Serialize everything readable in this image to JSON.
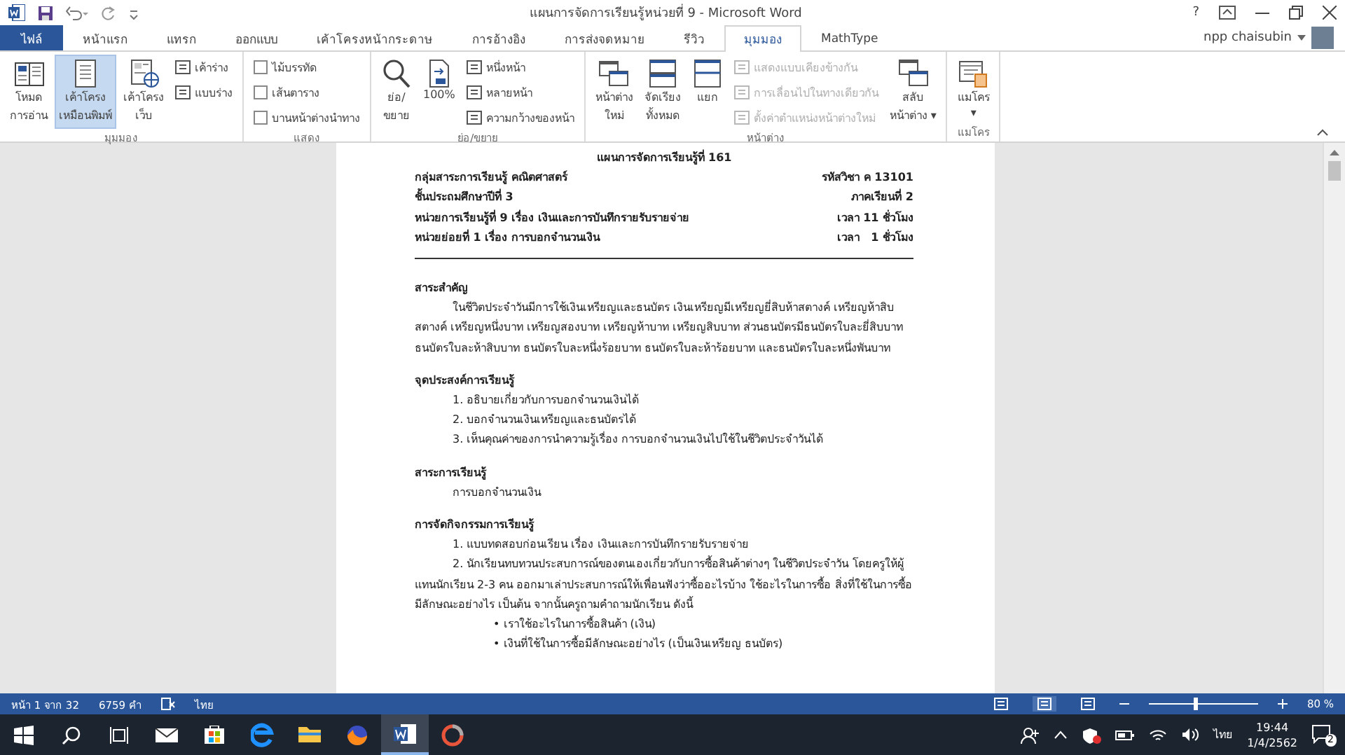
{
  "title_bar": {
    "title": "แผนการจัดการเรียนรู้หน่วยที่ 9 - Microsoft Word",
    "help": "?"
  },
  "tabs": [
    {
      "label": "ไฟล์",
      "kind": "file",
      "selected": false
    },
    {
      "label": "หน้าแรก",
      "kind": "tab",
      "selected": false
    },
    {
      "label": "แทรก",
      "kind": "tab",
      "selected": false
    },
    {
      "label": "ออกแบบ",
      "kind": "tab",
      "selected": false
    },
    {
      "label": "เค้าโครงหน้ากระดาษ",
      "kind": "tab",
      "selected": false
    },
    {
      "label": "การอ้างอิง",
      "kind": "tab",
      "selected": false
    },
    {
      "label": "การส่งจดหมาย",
      "kind": "tab",
      "selected": false
    },
    {
      "label": "รีวิว",
      "kind": "tab",
      "selected": false
    },
    {
      "label": "มุมมอง",
      "kind": "tab",
      "selected": true
    },
    {
      "label": "MathType",
      "kind": "tab",
      "selected": false
    }
  ],
  "account": {
    "user": "npp chaisubin"
  },
  "ribbon": {
    "groups": [
      {
        "label": "มุมมอง",
        "columns": [
          {
            "kind": "large",
            "lines": [
              "โหมด",
              "การอ่าน"
            ],
            "selected": false
          },
          {
            "kind": "large",
            "lines": [
              "เค้าโครง",
              "เหมือนพิมพ์"
            ],
            "selected": true
          },
          {
            "kind": "large",
            "lines": [
              "เค้าโครง",
              "เว็บ"
            ],
            "selected": false
          },
          {
            "kind": "stack",
            "items": [
              {
                "label": "เค้าร่าง",
                "selected": false
              },
              {
                "label": "แบบร่าง",
                "selected": false
              }
            ]
          }
        ]
      },
      {
        "label": "แสดง",
        "columns": [
          {
            "kind": "checks",
            "items": [
              {
                "label": "ไม้บรรทัด",
                "checked": false
              },
              {
                "label": "เส้นตาราง",
                "checked": false
              },
              {
                "label": "บานหน้าต่างนำทาง",
                "checked": false
              }
            ]
          }
        ]
      },
      {
        "label": "ย่อ/ขยาย",
        "columns": [
          {
            "kind": "large",
            "lines": [
              "ย่อ/",
              "ขยาย"
            ]
          },
          {
            "kind": "large",
            "lines": [
              "100%"
            ]
          },
          {
            "kind": "stack",
            "items": [
              {
                "label": "หนึ่งหน้า"
              },
              {
                "label": "หลายหน้า"
              },
              {
                "label": "ความกว้างของหน้า"
              }
            ]
          }
        ]
      },
      {
        "label": "หน้าต่าง",
        "columns": [
          {
            "kind": "large",
            "lines": [
              "หน้าต่าง",
              "ใหม่"
            ]
          },
          {
            "kind": "large",
            "lines": [
              "จัดเรียง",
              "ทั้งหมด"
            ]
          },
          {
            "kind": "large",
            "lines": [
              "แยก"
            ]
          },
          {
            "kind": "stack",
            "items": [
              {
                "label": "แสดงแบบเคียงข้างกัน",
                "disabled": true
              },
              {
                "label": "การเลื่อนไปในทางเดียวกัน",
                "disabled": true
              },
              {
                "label": "ตั้งค่าตำแหน่งหน้าต่างใหม่",
                "disabled": true
              }
            ]
          },
          {
            "kind": "large",
            "lines": [
              "สลับ",
              "หน้าต่าง ▾"
            ]
          }
        ]
      },
      {
        "label": "แมโคร",
        "columns": [
          {
            "kind": "large",
            "lines": [
              "แมโคร",
              "▾"
            ]
          }
        ]
      }
    ]
  },
  "document": {
    "title": "แผนการจัดการเรียนรู้ที่ 161",
    "header_rows": [
      {
        "left": "กลุ่มสาระการเรียนรู้ คณิตศาสตร์",
        "right": "รหัสวิชา ค 13101"
      },
      {
        "left": "ชั้นประถมศึกษาปีที่ 3",
        "right": "ภาคเรียนที่ 2"
      },
      {
        "left": "หน่วยการเรียนรู้ที่ 9 เรื่อง เงินและการบันทึกรายรับรายจ่าย",
        "right": "เวลา 11 ชั่วโมง"
      },
      {
        "left": "หน่วยย่อยที่ 1 เรื่อง การบอกจำนวนเงิน",
        "right": "เวลา   1 ชั่วโมง"
      }
    ],
    "sections": [
      {
        "heading": "สาระสำคัญ",
        "paragraphs": [
          {
            "kind": "para",
            "text": "ในชีวิตประจำวันมีการใช้เงินเหรียญและธนบัตร เงินเหรียญมีเหรียญยี่สิบห้าสตางค์ เหรียญห้าสิบสตางค์ เหรียญหนึ่งบาท เหรียญสองบาท เหรียญห้าบาท เหรียญสิบบาท ส่วนธนบัตรมีธนบัตรใบละยี่สิบบาท ธนบัตรใบละห้าสิบบาท ธนบัตรใบละหนึ่งร้อยบาท ธนบัตรใบละห้าร้อยบาท และธนบัตรใบละหนึ่งพันบาท"
          }
        ]
      },
      {
        "heading": "จุดประสงค์การเรียนรู้",
        "paragraphs": [
          {
            "kind": "item",
            "text": "1. อธิบายเกี่ยวกับการบอกจำนวนเงินได้"
          },
          {
            "kind": "item",
            "text": "2. บอกจำนวนเงินเหรียญและธนบัตรได้"
          },
          {
            "kind": "item",
            "text": "3. เห็นคุณค่าของการนำความรู้เรื่อง การบอกจำนวนเงินไปใช้ในชีวิตประจำวันได้"
          }
        ]
      },
      {
        "heading": "สาระการเรียนรู้",
        "paragraphs": [
          {
            "kind": "item",
            "text": "การบอกจำนวนเงิน"
          }
        ]
      },
      {
        "heading": "การจัดกิจกรรมการเรียนรู้",
        "paragraphs": [
          {
            "kind": "item",
            "text": "1. แบบทดสอบก่อนเรียน เรื่อง เงินและการบันทึกรายรับรายจ่าย"
          },
          {
            "kind": "para",
            "text": "2. นักเรียนทบทวนประสบการณ์ของตนเองเกี่ยวกับการซื้อสินค้าต่างๆ ในชีวิตประจำวัน โดยครูให้ผู้แทนนักเรียน 2-3 คน ออกมาเล่าประสบการณ์ให้เพื่อนฟังว่าซื้ออะไรบ้าง ใช้อะไรในการซื้อ สิ่งที่ใช้ในการซื้อมีลักษณะอย่างไร เป็นต้น จากนั้นครูถามคำถามนักเรียน ดังนี้"
          },
          {
            "kind": "bullet",
            "text": "• เราใช้อะไรในการซื้อสินค้า (เงิน)"
          },
          {
            "kind": "bullet",
            "text": "• เงินที่ใช้ในการซื้อมีลักษณะอย่างไร (เป็นเงินเหรียญ ธนบัตร)"
          }
        ]
      }
    ]
  },
  "status_bar": {
    "page": "หน้า 1 จาก 32",
    "words": "6759 คำ",
    "language": "ไทย",
    "views": [
      {
        "selected": false
      },
      {
        "selected": true
      },
      {
        "selected": false
      }
    ],
    "zoom_slider": {
      "level": 0.42
    },
    "zoom": "80 %"
  },
  "taskbar": {
    "apps": [
      {
        "selected": false
      },
      {
        "selected": false
      },
      {
        "selected": false
      },
      {
        "selected": false
      },
      {
        "selected": false
      },
      {
        "selected": true
      },
      {
        "selected": false
      }
    ],
    "language": "ไทย",
    "time": "19:44",
    "date": "1/4/2562",
    "notifications": "2"
  }
}
